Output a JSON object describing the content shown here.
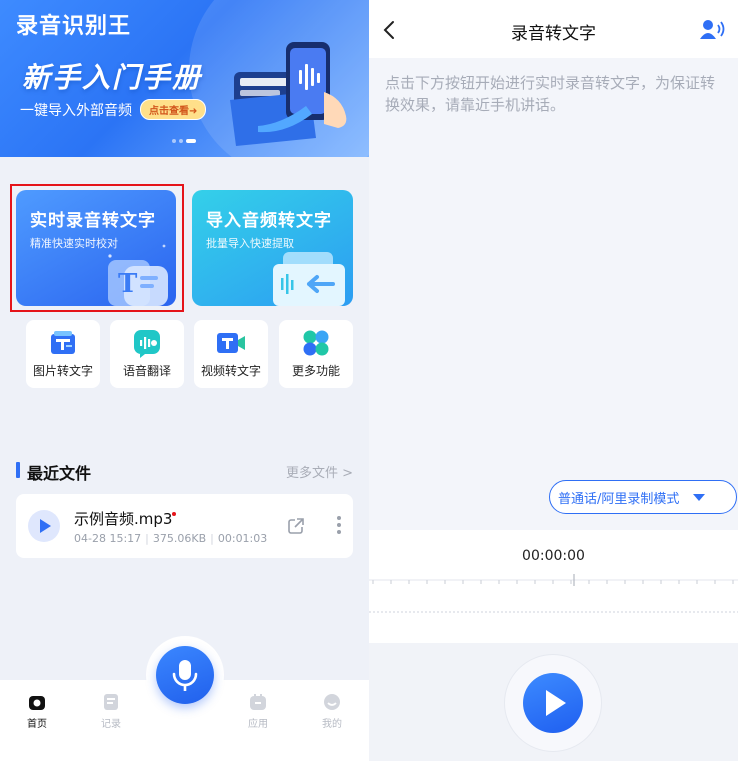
{
  "left": {
    "app_title": "录音识别王",
    "banner": {
      "headline": "新手入门手册",
      "subtitle": "一键导入外部音频",
      "chip": "点击查看➜"
    },
    "cards": [
      {
        "title": "实时录音转文字",
        "subtitle": "精准快速实时校对"
      },
      {
        "title": "导入音频转文字",
        "subtitle": "批量导入快速提取"
      }
    ],
    "tools": [
      {
        "label": "图片转文字",
        "icon": "image-to-text-icon"
      },
      {
        "label": "语音翻译",
        "icon": "voice-translate-icon"
      },
      {
        "label": "视频转文字",
        "icon": "video-to-text-icon"
      },
      {
        "label": "更多功能",
        "icon": "more-features-icon"
      }
    ],
    "recent": {
      "title": "最近文件",
      "more": "更多文件 >",
      "file": {
        "name": "示例音频.mp3",
        "date": "04-28 15:17",
        "size": "375.06KB",
        "duration": "00:01:03"
      }
    },
    "nav": [
      {
        "label": "首页",
        "icon": "home-icon"
      },
      {
        "label": "记录",
        "icon": "records-icon"
      },
      {
        "label": "应用",
        "icon": "apps-icon"
      },
      {
        "label": "我的",
        "icon": "profile-icon"
      }
    ]
  },
  "right": {
    "title": "录音转文字",
    "hint": "点击下方按钮开始进行实时录音转文字，为保证转换效果，请靠近手机讲话。",
    "mode": "普通话/阿里录制模式",
    "timer": "00:00:00"
  },
  "colors": {
    "accent": "#2f6ff5",
    "highlight": "#e5141a"
  }
}
